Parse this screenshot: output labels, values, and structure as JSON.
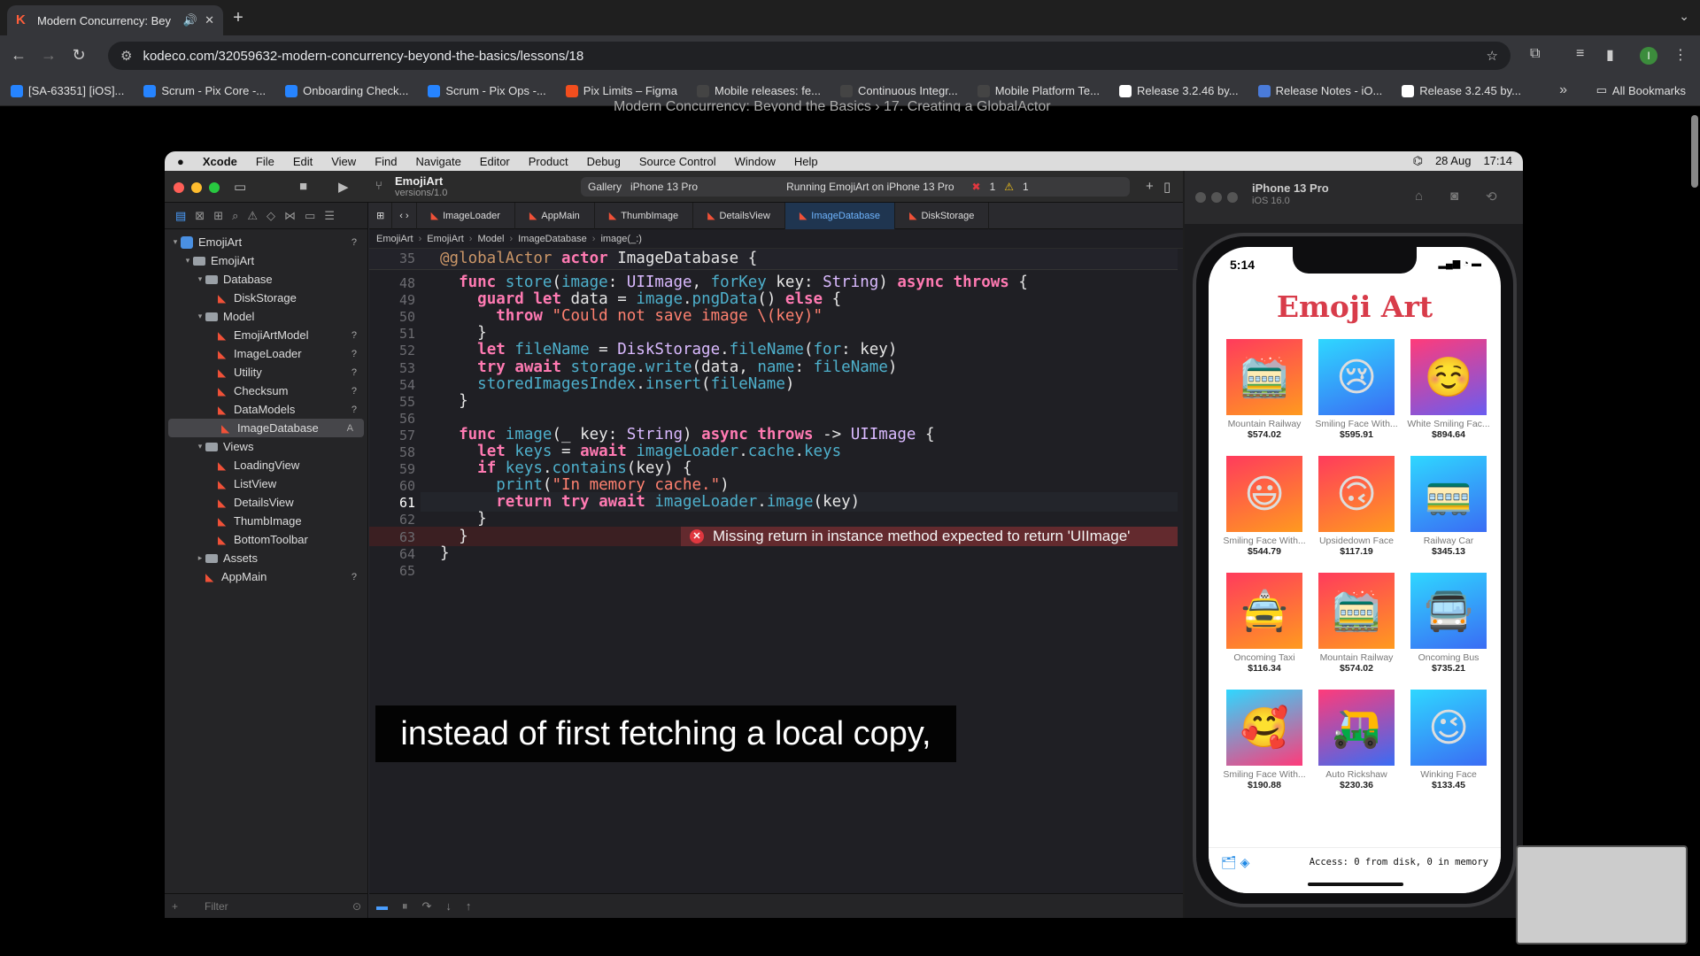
{
  "browser": {
    "tab_title": "Modern Concurrency: Bey",
    "url": "kodeco.com/32059632-modern-concurrency-beyond-the-basics/lessons/18",
    "bookmarks": [
      {
        "label": "[SA-63351] [iOS]...",
        "color": "#2684ff"
      },
      {
        "label": "Scrum - Pix Core -...",
        "color": "#2684ff"
      },
      {
        "label": "Onboarding Check...",
        "color": "#2684ff"
      },
      {
        "label": "Scrum - Pix Ops -...",
        "color": "#2684ff"
      },
      {
        "label": "Pix Limits – Figma",
        "color": "#f24e1e"
      },
      {
        "label": "Mobile releases: fe...",
        "color": "#444444"
      },
      {
        "label": "Continuous Integr...",
        "color": "#444444"
      },
      {
        "label": "Mobile Platform Te...",
        "color": "#444444"
      },
      {
        "label": "Release 3.2.46 by...",
        "color": "#ffffff"
      },
      {
        "label": "Release Notes - iO...",
        "color": "#4a7bd9"
      },
      {
        "label": "Release 3.2.45 by...",
        "color": "#ffffff"
      }
    ],
    "all_bookmarks": "All Bookmarks",
    "page_breadcrumb": "Modern Concurrency: Beyond the Basics  ›  17. Creating a GlobalActor",
    "avatar_letter": "I"
  },
  "menubar": {
    "app": "Xcode",
    "items": [
      "File",
      "Edit",
      "View",
      "Find",
      "Navigate",
      "Editor",
      "Product",
      "Debug",
      "Source Control",
      "Window",
      "Help"
    ],
    "date": "28 Aug",
    "time": "17:14"
  },
  "xcode": {
    "project": "EmojiArt",
    "branch": "versions/1.0",
    "scheme": "Gallery",
    "device": "iPhone 13 Pro",
    "status": "Running EmojiArt on iPhone 13 Pro",
    "errors": "1",
    "warnings": "1",
    "tabs": [
      "ImageLoader",
      "AppMain",
      "ThumbImage",
      "DetailsView",
      "ImageDatabase",
      "DiskStorage"
    ],
    "active_tab": "ImageDatabase",
    "jumpbar": [
      "EmojiArt",
      "EmojiArt",
      "Model",
      "ImageDatabase",
      "image(_:)"
    ],
    "tree": [
      {
        "label": "EmojiArt",
        "depth": 0,
        "kind": "project",
        "badge": "?"
      },
      {
        "label": "EmojiArt",
        "depth": 1,
        "kind": "folder",
        "badge": ""
      },
      {
        "label": "Database",
        "depth": 2,
        "kind": "folder",
        "badge": ""
      },
      {
        "label": "DiskStorage",
        "depth": 3,
        "kind": "swift",
        "badge": ""
      },
      {
        "label": "Model",
        "depth": 2,
        "kind": "folder",
        "badge": ""
      },
      {
        "label": "EmojiArtModel",
        "depth": 3,
        "kind": "swift",
        "badge": "?"
      },
      {
        "label": "ImageLoader",
        "depth": 3,
        "kind": "swift",
        "badge": "?"
      },
      {
        "label": "Utility",
        "depth": 3,
        "kind": "swift",
        "badge": "?"
      },
      {
        "label": "Checksum",
        "depth": 3,
        "kind": "swift",
        "badge": "?"
      },
      {
        "label": "DataModels",
        "depth": 3,
        "kind": "swift",
        "badge": "?"
      },
      {
        "label": "ImageDatabase",
        "depth": 3,
        "kind": "swift",
        "badge": "A"
      },
      {
        "label": "Views",
        "depth": 2,
        "kind": "folder",
        "badge": ""
      },
      {
        "label": "LoadingView",
        "depth": 3,
        "kind": "swift",
        "badge": ""
      },
      {
        "label": "ListView",
        "depth": 3,
        "kind": "swift",
        "badge": ""
      },
      {
        "label": "DetailsView",
        "depth": 3,
        "kind": "swift",
        "badge": ""
      },
      {
        "label": "ThumbImage",
        "depth": 3,
        "kind": "swift",
        "badge": ""
      },
      {
        "label": "BottomToolbar",
        "depth": 3,
        "kind": "swift",
        "badge": ""
      },
      {
        "label": "Assets",
        "depth": 2,
        "kind": "folder",
        "badge": ""
      },
      {
        "label": "AppMain",
        "depth": 2,
        "kind": "swift",
        "badge": "?"
      }
    ],
    "filter_placeholder": "Filter",
    "sticky_line": {
      "num": "35",
      "text": "@globalActor actor ImageDatabase {"
    },
    "code": [
      {
        "num": "48",
        "text": "  func store(image: UIImage, forKey key: String) async throws {"
      },
      {
        "num": "49",
        "text": "    guard let data = image.pngData() else {"
      },
      {
        "num": "50",
        "text": "      throw \"Could not save image \\(key)\""
      },
      {
        "num": "51",
        "text": "    }"
      },
      {
        "num": "52",
        "text": "    let fileName = DiskStorage.fileName(for: key)"
      },
      {
        "num": "53",
        "text": "    try await storage.write(data, name: fileName)"
      },
      {
        "num": "54",
        "text": "    storedImagesIndex.insert(fileName)"
      },
      {
        "num": "55",
        "text": "  }"
      },
      {
        "num": "56",
        "text": ""
      },
      {
        "num": "57",
        "text": "  func image(_ key: String) async throws -> UIImage {"
      },
      {
        "num": "58",
        "text": "    let keys = await imageLoader.cache.keys"
      },
      {
        "num": "59",
        "text": "    if keys.contains(key) {"
      },
      {
        "num": "60",
        "text": "      print(\"In memory cache.\")"
      },
      {
        "num": "61",
        "text": "      return try await imageLoader.image(key)"
      },
      {
        "num": "62",
        "text": "    }"
      },
      {
        "num": "63",
        "text": "  }"
      },
      {
        "num": "64",
        "text": "}"
      },
      {
        "num": "65",
        "text": ""
      }
    ],
    "current_line": "61",
    "error_line": "63",
    "error_message": "Missing return in instance method expected to return 'UIImage'"
  },
  "caption": "instead of first fetching a local copy,",
  "simulator": {
    "device": "iPhone 13 Pro",
    "os": "iOS 16.0",
    "time": "5:14",
    "app_title": "Emoji Art",
    "items": [
      {
        "emoji": "🚞",
        "name": "Mountain Railway",
        "price": "$574.02",
        "grad": "linear-gradient(160deg,#ff3b5c,#ff9a1f)"
      },
      {
        "emoji": "😢",
        "name": "Smiling Face With...",
        "price": "$595.91",
        "grad": "linear-gradient(160deg,#2fd7ff,#3a6cf4)"
      },
      {
        "emoji": "☺️",
        "name": "White Smiling Fac...",
        "price": "$894.64",
        "grad": "linear-gradient(160deg,#ff3b7a,#6a5cf0)"
      },
      {
        "emoji": "😃",
        "name": "Smiling Face With...",
        "price": "$544.79",
        "grad": "linear-gradient(160deg,#ff3b5c,#ff9a1f)"
      },
      {
        "emoji": "🙃",
        "name": "Upsidedown Face",
        "price": "$117.19",
        "grad": "linear-gradient(160deg,#ff3b5c,#ff9a1f)"
      },
      {
        "emoji": "🚃",
        "name": "Railway Car",
        "price": "$345.13",
        "grad": "linear-gradient(160deg,#2fd7ff,#3a6cf4)"
      },
      {
        "emoji": "🚖",
        "name": "Oncoming Taxi",
        "price": "$116.34",
        "grad": "linear-gradient(160deg,#ff3b5c,#ff9a1f)"
      },
      {
        "emoji": "🚞",
        "name": "Mountain Railway",
        "price": "$574.02",
        "grad": "linear-gradient(160deg,#ff3b5c,#ff9a1f)"
      },
      {
        "emoji": "🚍",
        "name": "Oncoming Bus",
        "price": "$735.21",
        "grad": "linear-gradient(160deg,#2fd7ff,#3a6cf4)"
      },
      {
        "emoji": "🥰",
        "name": "Smiling Face With...",
        "price": "$190.88",
        "grad": "linear-gradient(160deg,#2fd7ff,#ff3b7a)"
      },
      {
        "emoji": "🛺",
        "name": "Auto Rickshaw",
        "price": "$230.36",
        "grad": "linear-gradient(160deg,#ff3b7a,#3a6cf4)"
      },
      {
        "emoji": "😉",
        "name": "Winking Face",
        "price": "$133.45",
        "grad": "linear-gradient(160deg,#2fd7ff,#3a6cf4)"
      },
      {
        "emoji": "😊",
        "name": "",
        "price": "",
        "grad": "linear-gradient(160deg,#2fd7ff,#3a6cf4)"
      },
      {
        "emoji": "😰",
        "name": "",
        "price": "",
        "grad": "linear-gradient(160deg,#2fd7ff,#3a6cf4)"
      },
      {
        "emoji": "🤣",
        "name": "",
        "price": "",
        "grad": "linear-gradient(160deg,#ff3b5c,#ff9a1f)"
      }
    ],
    "footer": "Access: 0 from disk, 0 in memory"
  }
}
